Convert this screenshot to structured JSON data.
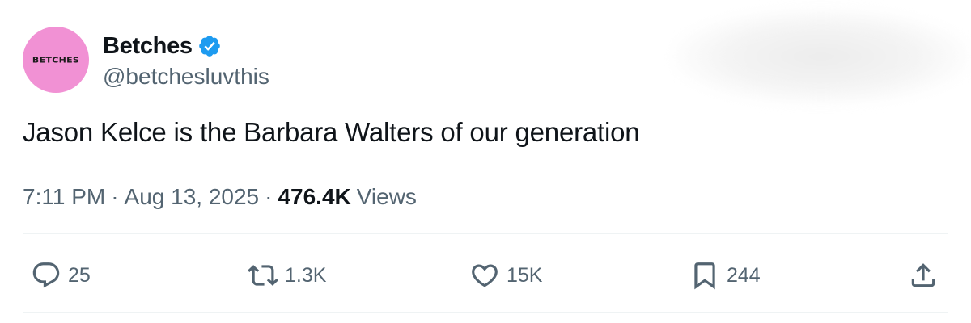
{
  "author": {
    "avatar_text": "BETCHES",
    "avatar_color": "#f191d4",
    "display_name": "Betches",
    "handle": "@betchesluvthis",
    "verified": true,
    "verified_color": "#1d9bf0"
  },
  "tweet": {
    "text": "Jason Kelce is the Barbara Walters of our generation",
    "time": "7:11 PM",
    "separator": "·",
    "date": "Aug 13, 2025",
    "views_count": "476.4K",
    "views_label": "Views"
  },
  "actions": {
    "reply": {
      "icon": "reply-icon",
      "count": "25"
    },
    "retweet": {
      "icon": "retweet-icon",
      "count": "1.3K"
    },
    "like": {
      "icon": "heart-icon",
      "count": "15K"
    },
    "bookmark": {
      "icon": "bookmark-icon",
      "count": "244"
    },
    "share": {
      "icon": "share-icon"
    }
  },
  "colors": {
    "text_primary": "#0f1419",
    "text_secondary": "#536471",
    "divider": "#eff3f4"
  }
}
